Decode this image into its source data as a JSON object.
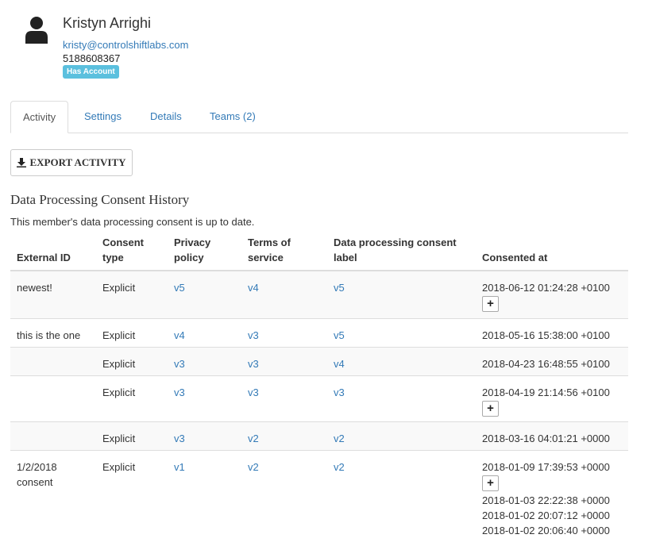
{
  "member": {
    "name": "Kristyn Arrighi",
    "email": "kristy@controlshiftlabs.com",
    "phone": "5188608367",
    "badge": "Has Account"
  },
  "tabs": [
    {
      "label": "Activity",
      "active": true
    },
    {
      "label": "Settings",
      "active": false
    },
    {
      "label": "Details",
      "active": false
    },
    {
      "label": "Teams (2)",
      "active": false
    }
  ],
  "export_button": "EXPORT ACTIVITY",
  "section_title": "Data Processing Consent History",
  "consent_status": "This member's data processing consent is up to date.",
  "table": {
    "headers": {
      "external_id": "External ID",
      "consent_type": [
        "Consent",
        "type"
      ],
      "privacy_policy": [
        "Privacy",
        "policy"
      ],
      "terms": [
        "Terms of",
        "service"
      ],
      "label": [
        "Data processing consent",
        "label"
      ],
      "consented_at": "Consented at"
    },
    "expand_label": "+",
    "rows": [
      {
        "external_id": "newest!",
        "consent_type": "Explicit",
        "privacy": "v5",
        "terms": "v4",
        "label": "v5",
        "times": [
          "2018-06-12 01:24:28 +0100"
        ],
        "expandable": true
      },
      {
        "external_id": "this is the one",
        "consent_type": "Explicit",
        "privacy": "v4",
        "terms": "v3",
        "label": "v5",
        "times": [
          "2018-05-16 15:38:00 +0100"
        ],
        "expandable": false
      },
      {
        "external_id": "",
        "consent_type": "Explicit",
        "privacy": "v3",
        "terms": "v3",
        "label": "v4",
        "times": [
          "2018-04-23 16:48:55 +0100"
        ],
        "expandable": false
      },
      {
        "external_id": "",
        "consent_type": "Explicit",
        "privacy": "v3",
        "terms": "v3",
        "label": "v3",
        "times": [
          "2018-04-19 21:14:56 +0100"
        ],
        "expandable": true
      },
      {
        "external_id": "",
        "consent_type": "Explicit",
        "privacy": "v3",
        "terms": "v2",
        "label": "v2",
        "times": [
          "2018-03-16 04:01:21 +0000"
        ],
        "expandable": false
      },
      {
        "external_id": "1/2/2018 consent",
        "consent_type": "Explicit",
        "privacy": "v1",
        "terms": "v2",
        "label": "v2",
        "times": [
          "2018-01-09 17:39:53 +0000"
        ],
        "expandable": true,
        "extra_times": [
          "2018-01-03 22:22:38 +0000",
          "2018-01-02 20:07:12 +0000",
          "2018-01-02 20:06:40 +0000"
        ]
      }
    ]
  }
}
